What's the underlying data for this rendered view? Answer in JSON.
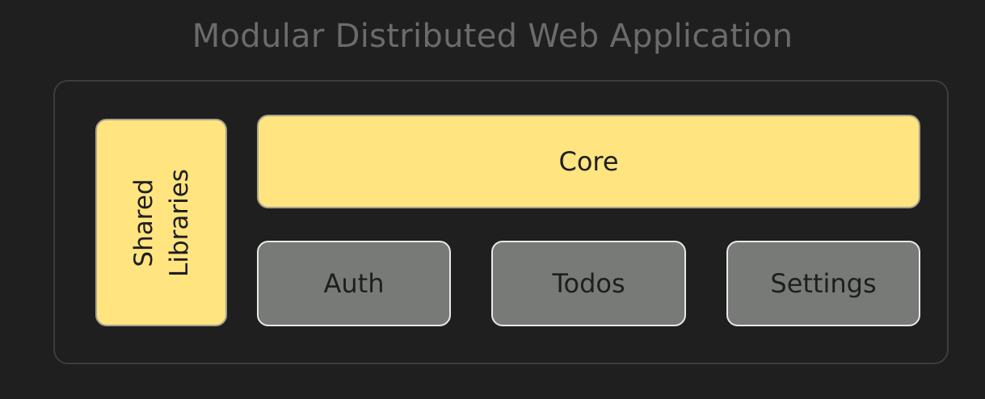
{
  "title": "Modular Distributed Web Application",
  "blocks": {
    "shared_libraries": {
      "line1": "Shared",
      "line2": "Libraries"
    },
    "core": "Core",
    "auth": "Auth",
    "todos": "Todos",
    "settings": "Settings"
  },
  "colors": {
    "background": "#1f1f1f",
    "title": "#6b6b6b",
    "frame_border": "#3d3d3d",
    "yellow_fill": "#ffe480",
    "gray_fill": "#787a78",
    "gray_border": "#e8e8e8"
  }
}
